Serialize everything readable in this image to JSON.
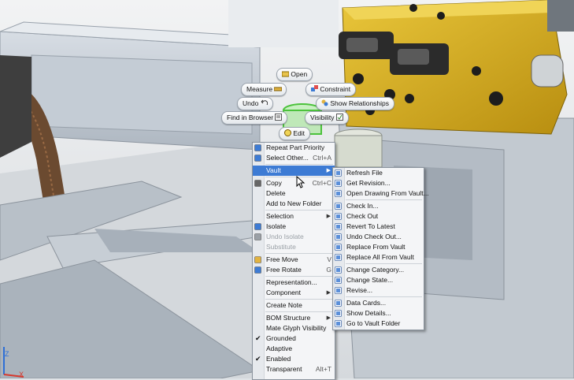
{
  "marking_menu": {
    "open": "Open",
    "measure": "Measure",
    "constraint": "Constraint",
    "undo": "Undo",
    "show_relationships": "Show Relationships",
    "find_in_browser": "Find in Browser",
    "visibility": "Visibility",
    "edit": "Edit"
  },
  "context_menu": {
    "items": [
      {
        "label": "Repeat Part Priority",
        "shortcut": "",
        "icon": "repeat-icon",
        "state": "normal"
      },
      {
        "label": "Select Other...",
        "shortcut": "Ctrl+A",
        "icon": "select-icon",
        "state": "normal"
      },
      {
        "label": "Vault",
        "shortcut": "",
        "icon": "",
        "state": "highlighted",
        "submenu": true
      },
      {
        "label": "Copy",
        "shortcut": "Ctrl+C",
        "icon": "copy-icon",
        "state": "normal"
      },
      {
        "label": "Delete",
        "shortcut": "",
        "icon": "",
        "state": "normal"
      },
      {
        "label": "Add to New Folder",
        "shortcut": "",
        "icon": "",
        "state": "normal"
      },
      {
        "label": "Selection",
        "shortcut": "",
        "icon": "",
        "state": "normal",
        "submenu": true
      },
      {
        "label": "Isolate",
        "shortcut": "",
        "icon": "isolate-icon",
        "state": "normal"
      },
      {
        "label": "Undo Isolate",
        "shortcut": "",
        "icon": "undo-isolate-icon",
        "state": "disabled"
      },
      {
        "label": "Substitute",
        "shortcut": "",
        "icon": "",
        "state": "disabled"
      },
      {
        "label": "Free Move",
        "shortcut": "V",
        "icon": "free-move-icon",
        "state": "normal"
      },
      {
        "label": "Free Rotate",
        "shortcut": "G",
        "icon": "free-rotate-icon",
        "state": "normal"
      },
      {
        "label": "Representation...",
        "shortcut": "",
        "icon": "",
        "state": "normal"
      },
      {
        "label": "Component",
        "shortcut": "",
        "icon": "",
        "state": "normal",
        "submenu": true
      },
      {
        "label": "Create Note",
        "shortcut": "",
        "icon": "",
        "state": "normal"
      },
      {
        "label": "BOM Structure",
        "shortcut": "",
        "icon": "",
        "state": "normal",
        "submenu": true
      },
      {
        "label": "Mate Glyph Visibility",
        "shortcut": "",
        "icon": "",
        "state": "normal"
      },
      {
        "label": "Grounded",
        "shortcut": "",
        "icon": "",
        "state": "checked"
      },
      {
        "label": "Adaptive",
        "shortcut": "",
        "icon": "",
        "state": "normal"
      },
      {
        "label": "Enabled",
        "shortcut": "",
        "icon": "",
        "state": "checked"
      },
      {
        "label": "Transparent",
        "shortcut": "Alt+T",
        "icon": "",
        "state": "normal"
      }
    ]
  },
  "vault_submenu": {
    "items": [
      {
        "label": "Refresh File",
        "icon": "refresh-icon"
      },
      {
        "label": "Get Revision...",
        "icon": "get-revision-icon"
      },
      {
        "label": "Open Drawing From Vault...",
        "icon": "open-drawing-icon"
      },
      {
        "label": "Check In...",
        "icon": "check-in-icon"
      },
      {
        "label": "Check Out",
        "icon": "check-out-icon"
      },
      {
        "label": "Revert To Latest",
        "icon": "revert-icon"
      },
      {
        "label": "Undo Check Out...",
        "icon": "undo-checkout-icon"
      },
      {
        "label": "Replace From Vault",
        "icon": "replace-icon"
      },
      {
        "label": "Replace All From Vault",
        "icon": "replace-all-icon"
      },
      {
        "label": "Change Category...",
        "icon": "category-icon"
      },
      {
        "label": "Change State...",
        "icon": "state-icon"
      },
      {
        "label": "Revise...",
        "icon": "revise-icon"
      },
      {
        "label": "Data Cards...",
        "icon": "data-cards-icon"
      },
      {
        "label": "Show Details...",
        "icon": "details-icon"
      },
      {
        "label": "Go to Vault Folder",
        "icon": "vault-folder-icon"
      }
    ]
  },
  "colors": {
    "highlight": "#3d7bd4",
    "yellow_block": "#d8b01c",
    "steel": "#c9cfd6"
  }
}
